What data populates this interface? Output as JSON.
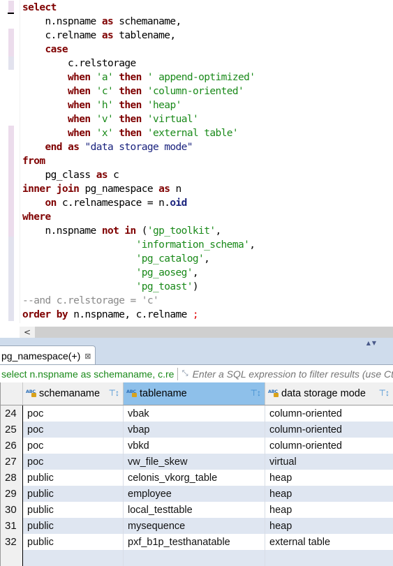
{
  "editor": {
    "lines": [
      [
        {
          "t": "select",
          "c": "kw"
        }
      ],
      [
        {
          "t": "    n.nspname ",
          "c": ""
        },
        {
          "t": "as",
          "c": "kw"
        },
        {
          "t": " schemaname,",
          "c": ""
        }
      ],
      [
        {
          "t": "    c.relname ",
          "c": ""
        },
        {
          "t": "as",
          "c": "kw"
        },
        {
          "t": " tablename,",
          "c": ""
        }
      ],
      [
        {
          "t": "    ",
          "c": ""
        },
        {
          "t": "case",
          "c": "kw"
        }
      ],
      [
        {
          "t": "        c.relstorage",
          "c": ""
        }
      ],
      [
        {
          "t": "        ",
          "c": ""
        },
        {
          "t": "when",
          "c": "kw"
        },
        {
          "t": " ",
          "c": ""
        },
        {
          "t": "'a'",
          "c": "str"
        },
        {
          "t": " ",
          "c": ""
        },
        {
          "t": "then",
          "c": "kw"
        },
        {
          "t": " ",
          "c": ""
        },
        {
          "t": "' append-optimized'",
          "c": "str"
        }
      ],
      [
        {
          "t": "        ",
          "c": ""
        },
        {
          "t": "when",
          "c": "kw"
        },
        {
          "t": " ",
          "c": ""
        },
        {
          "t": "'c'",
          "c": "str"
        },
        {
          "t": " ",
          "c": ""
        },
        {
          "t": "then",
          "c": "kw"
        },
        {
          "t": " ",
          "c": ""
        },
        {
          "t": "'column-oriented'",
          "c": "str"
        }
      ],
      [
        {
          "t": "        ",
          "c": ""
        },
        {
          "t": "when",
          "c": "kw"
        },
        {
          "t": " ",
          "c": ""
        },
        {
          "t": "'h'",
          "c": "str"
        },
        {
          "t": " ",
          "c": ""
        },
        {
          "t": "then",
          "c": "kw"
        },
        {
          "t": " ",
          "c": ""
        },
        {
          "t": "'heap'",
          "c": "str"
        }
      ],
      [
        {
          "t": "        ",
          "c": ""
        },
        {
          "t": "when",
          "c": "kw"
        },
        {
          "t": " ",
          "c": ""
        },
        {
          "t": "'v'",
          "c": "str"
        },
        {
          "t": " ",
          "c": ""
        },
        {
          "t": "then",
          "c": "kw"
        },
        {
          "t": " ",
          "c": ""
        },
        {
          "t": "'virtual'",
          "c": "str"
        }
      ],
      [
        {
          "t": "        ",
          "c": ""
        },
        {
          "t": "when",
          "c": "kw"
        },
        {
          "t": " ",
          "c": ""
        },
        {
          "t": "'x'",
          "c": "str"
        },
        {
          "t": " ",
          "c": ""
        },
        {
          "t": "then",
          "c": "kw"
        },
        {
          "t": " ",
          "c": ""
        },
        {
          "t": "'external table'",
          "c": "str"
        }
      ],
      [
        {
          "t": "    ",
          "c": ""
        },
        {
          "t": "end",
          "c": "kw"
        },
        {
          "t": " ",
          "c": ""
        },
        {
          "t": "as",
          "c": "kw"
        },
        {
          "t": " ",
          "c": ""
        },
        {
          "t": "\"data storage mode\"",
          "c": "ident"
        }
      ],
      [
        {
          "t": "from",
          "c": "kw"
        }
      ],
      [
        {
          "t": "    pg_class ",
          "c": ""
        },
        {
          "t": "as",
          "c": "kw"
        },
        {
          "t": " c",
          "c": ""
        }
      ],
      [
        {
          "t": "inner",
          "c": "kw"
        },
        {
          "t": " ",
          "c": ""
        },
        {
          "t": "join",
          "c": "kw"
        },
        {
          "t": " pg_namespace ",
          "c": ""
        },
        {
          "t": "as",
          "c": "kw"
        },
        {
          "t": " n",
          "c": ""
        }
      ],
      [
        {
          "t": "    ",
          "c": ""
        },
        {
          "t": "on",
          "c": "kw"
        },
        {
          "t": " c.relnamespace = n.",
          "c": ""
        },
        {
          "t": "oid",
          "c": "boldid"
        }
      ],
      [
        {
          "t": "where",
          "c": "kw"
        }
      ],
      [
        {
          "t": "    n.nspname ",
          "c": ""
        },
        {
          "t": "not",
          "c": "kw"
        },
        {
          "t": " ",
          "c": ""
        },
        {
          "t": "in",
          "c": "kw"
        },
        {
          "t": " (",
          "c": ""
        },
        {
          "t": "'gp_toolkit'",
          "c": "str"
        },
        {
          "t": ",",
          "c": ""
        }
      ],
      [
        {
          "t": "                    ",
          "c": ""
        },
        {
          "t": "'information_schema'",
          "c": "str"
        },
        {
          "t": ",",
          "c": ""
        }
      ],
      [
        {
          "t": "                    ",
          "c": ""
        },
        {
          "t": "'pg_catalog'",
          "c": "str"
        },
        {
          "t": ",",
          "c": ""
        }
      ],
      [
        {
          "t": "                    ",
          "c": ""
        },
        {
          "t": "'pg_aoseg'",
          "c": "str"
        },
        {
          "t": ",",
          "c": ""
        }
      ],
      [
        {
          "t": "                    ",
          "c": ""
        },
        {
          "t": "'pg_toast'",
          "c": "str"
        },
        {
          "t": ")",
          "c": ""
        }
      ],
      [
        {
          "t": "--and c.relstorage = 'c'",
          "c": "cmt"
        }
      ],
      [
        {
          "t": "order",
          "c": "kw"
        },
        {
          "t": " ",
          "c": ""
        },
        {
          "t": "by",
          "c": "kw"
        },
        {
          "t": " n.nspname, c.relname ",
          "c": ""
        },
        {
          "t": ";",
          "c": "red"
        }
      ]
    ]
  },
  "scrollbar": {
    "left_arrow": "<"
  },
  "results": {
    "tab_label": "pg_namespace(+)",
    "tab_close_icon": "close-icon",
    "minmax_icon": "▲▼",
    "filter_query": "select n.nspname as schemaname, c.re",
    "filter_placeholder": "Enter a SQL expression to filter results (use Ctrl+Space)",
    "columns": [
      {
        "label": "schemaname",
        "icon": "text-column-icon",
        "selected": false
      },
      {
        "label": "tablename",
        "icon": "text-column-icon",
        "selected": true
      },
      {
        "label": "data storage mode",
        "icon": "text-column-icon",
        "selected": false
      }
    ],
    "rows": [
      {
        "n": "24",
        "cells": [
          "poc",
          "vbak",
          "column-oriented"
        ]
      },
      {
        "n": "25",
        "cells": [
          "poc",
          "vbap",
          "column-oriented"
        ]
      },
      {
        "n": "26",
        "cells": [
          "poc",
          "vbkd",
          "column-oriented"
        ]
      },
      {
        "n": "27",
        "cells": [
          "poc",
          "vw_file_skew",
          "virtual"
        ]
      },
      {
        "n": "28",
        "cells": [
          "public",
          "celonis_vkorg_table",
          "heap"
        ]
      },
      {
        "n": "29",
        "cells": [
          "public",
          "employee",
          "heap"
        ]
      },
      {
        "n": "30",
        "cells": [
          "public",
          "local_testtable",
          "heap"
        ]
      },
      {
        "n": "31",
        "cells": [
          "public",
          "mysequence",
          "heap"
        ]
      },
      {
        "n": "32",
        "cells": [
          "public",
          "pxf_b1p_testhanatable",
          "external table"
        ]
      },
      {
        "n": "",
        "cells": [
          "",
          "",
          ""
        ]
      }
    ]
  }
}
